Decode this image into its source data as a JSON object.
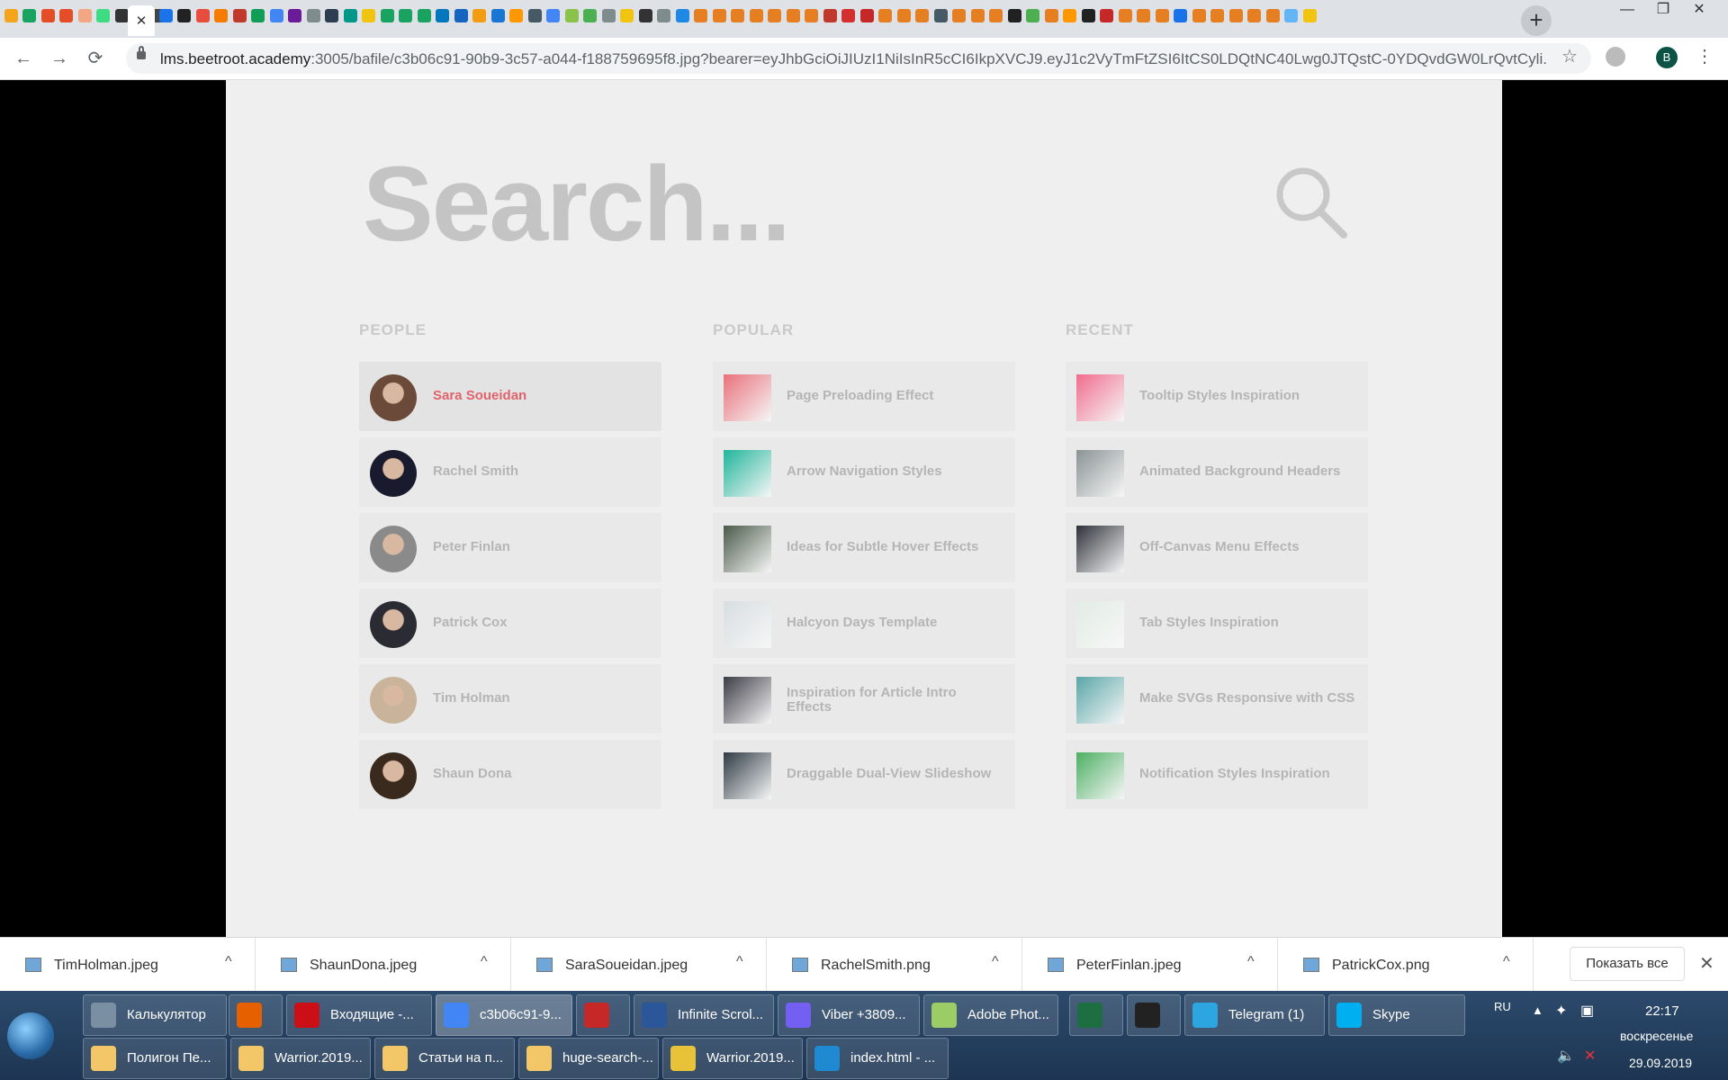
{
  "browser": {
    "favicon_colors": [
      "#f4a51c",
      "#1aa260",
      "#e44d26",
      "#e44d26",
      "#f3a683",
      "#3ddc84",
      "#333333",
      "#d93025",
      "#444444",
      "#1a73e8",
      "#222222",
      "#e74c3c",
      "#f57c00",
      "#c0392b",
      "#0f9d58",
      "#4285f4",
      "#6a1b9a",
      "#7f8c8d",
      "#2c3e50",
      "#009688",
      "#f1c40f",
      "#1aa260",
      "#1aa260",
      "#1aa260",
      "#0277bd",
      "#1565c0",
      "#f39c12",
      "#1976d2",
      "#ff9800",
      "#455a64",
      "#4285f4",
      "#8bc34a",
      "#4caf50",
      "#7f8c8d",
      "#f1c40f",
      "#333333",
      "#7f8c8d",
      "#1e88e5",
      "#e67e22",
      "#e67e22",
      "#e67e22",
      "#e67e22",
      "#e67e22",
      "#e67e22",
      "#e67e22",
      "#c0392b",
      "#d32f2f",
      "#c62828",
      "#e67e22",
      "#e67e22",
      "#e67e22",
      "#455a64",
      "#e67e22",
      "#e67e22",
      "#e67e22",
      "#212121",
      "#4caf50",
      "#e67e22",
      "#ff9800",
      "#212121",
      "#c62828",
      "#e67e22",
      "#e67e22",
      "#e67e22",
      "#1a73e8",
      "#e67e22",
      "#e67e22",
      "#e67e22",
      "#e67e22",
      "#e67e22",
      "#64b5f6",
      "#f1c40f"
    ],
    "active_tab_close": "✕",
    "new_tab": "+",
    "window_controls": {
      "minimize": "—",
      "restore": "❐",
      "close": "✕"
    },
    "nav": {
      "back": "←",
      "forward": "→",
      "reload": "⟳"
    },
    "url_host": "lms.beetroot.academy",
    "url_rest": ":3005/bafile/c3b06c91-90b9-3c57-a044-f188759695f8.jpg?bearer=eyJhbGciOiJIUzI1NiIsInR5cCI6IkpXVCJ9.eyJ1c2VyTmFtZSI6ItCS0LDQtNC40Lwg0JTQstC-0YDQvdGW0LrQvtCyli...",
    "star": "☆",
    "profile_initial": "B",
    "menu": "⋮"
  },
  "page": {
    "search_placeholder": "Search...",
    "columns": [
      {
        "heading": "PEOPLE",
        "items": [
          {
            "label": "Sara Soueidan",
            "selected": true,
            "color": "#6b4a3a"
          },
          {
            "label": "Rachel Smith",
            "selected": false,
            "color": "#1a1a2e"
          },
          {
            "label": "Peter Finlan",
            "selected": false,
            "color": "#8a8a8a"
          },
          {
            "label": "Patrick Cox",
            "selected": false,
            "color": "#2b2b33"
          },
          {
            "label": "Tim Holman",
            "selected": false,
            "color": "#c9b39a"
          },
          {
            "label": "Shaun Dona",
            "selected": false,
            "color": "#3a2a1e"
          }
        ]
      },
      {
        "heading": "POPULAR",
        "items": [
          {
            "label": "Page Preloading Effect",
            "color": "#e8707a"
          },
          {
            "label": "Arrow Navigation Styles",
            "color": "#1fb59a"
          },
          {
            "label": "Ideas for Subtle Hover Effects",
            "color": "#4a5a4a"
          },
          {
            "label": "Halcyon Days Template",
            "color": "#d7dde0"
          },
          {
            "label": "Inspiration for Article Intro Effects",
            "color": "#3c3c46"
          },
          {
            "label": "Draggable Dual-View Slideshow",
            "color": "#2e3a44"
          }
        ]
      },
      {
        "heading": "RECENT",
        "items": [
          {
            "label": "Tooltip Styles Inspiration",
            "color": "#f06b8c"
          },
          {
            "label": "Animated Background Headers",
            "color": "#8a9394"
          },
          {
            "label": "Off-Canvas Menu Effects",
            "color": "#2d3138"
          },
          {
            "label": "Tab Styles Inspiration",
            "color": "#e2ece6"
          },
          {
            "label": "Make SVGs Responsive with CSS",
            "color": "#5aa6a8"
          },
          {
            "label": "Notification Styles Inspiration",
            "color": "#4caf63"
          }
        ]
      }
    ]
  },
  "downloads": {
    "items": [
      "TimHolman.jpeg",
      "ShaunDona.jpeg",
      "SaraSoueidan.jpeg",
      "RachelSmith.png",
      "PeterFinlan.jpeg",
      "PatrickCox.png"
    ],
    "show_all": "Показать все",
    "close": "✕",
    "chevron": "^"
  },
  "taskbar": {
    "row1": [
      {
        "label": "Калькулятор",
        "color": "#7b8fa3"
      },
      {
        "label": "",
        "color": "#e66000"
      },
      {
        "label": "Входящие -...",
        "color": "#cc0f16"
      },
      {
        "label": "c3b06c91-9...",
        "color": "#4285f4",
        "active": true
      },
      {
        "label": "",
        "color": "#c62828"
      },
      {
        "label": "Infinite Scrol...",
        "color": "#2b579a"
      },
      {
        "label": "Viber +3809...",
        "color": "#7360f2"
      },
      {
        "label": "Adobe Phot...",
        "color": "#9ccc65"
      },
      {
        "label": "",
        "color": "#1d6f42"
      },
      {
        "label": "",
        "color": "#222222"
      },
      {
        "label": "Telegram (1)",
        "color": "#2ca5e0"
      },
      {
        "label": "Skype",
        "color": "#00aff0"
      }
    ],
    "row2": [
      {
        "label": "Полигон Пе...",
        "color": "#f3c768"
      },
      {
        "label": "Warrior.2019...",
        "color": "#f3c768"
      },
      {
        "label": "Статьи на п...",
        "color": "#f3c768"
      },
      {
        "label": "huge-search-...",
        "color": "#f3c768"
      },
      {
        "label": "Warrior.2019...",
        "color": "#e8c33a"
      },
      {
        "label": "index.html - ...",
        "color": "#1f8ad2"
      }
    ],
    "lang": "RU",
    "time": "22:17",
    "day": "воскресенье",
    "date": "29.09.2019"
  }
}
